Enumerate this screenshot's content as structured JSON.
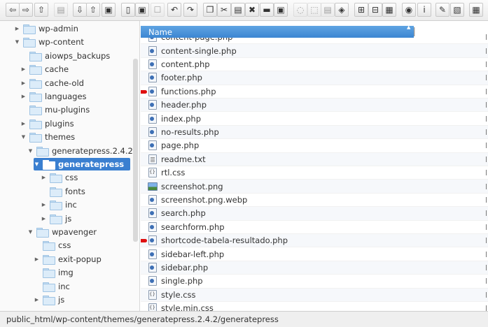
{
  "toolbar": {
    "buttons": [
      {
        "name": "back-icon",
        "glyph": "⇦"
      },
      {
        "name": "forward-icon",
        "glyph": "⇨"
      },
      {
        "name": "up-icon",
        "glyph": "⇧"
      },
      {
        "name": "home-icon",
        "glyph": "▤"
      },
      {
        "name": "download-icon",
        "glyph": "⇩"
      },
      {
        "name": "upload-icon",
        "glyph": "⇧"
      },
      {
        "name": "save-icon",
        "glyph": "▣"
      },
      {
        "name": "open-icon",
        "glyph": "▯"
      },
      {
        "name": "disk-icon",
        "glyph": "▣"
      },
      {
        "name": "checkbox-icon",
        "glyph": "☐"
      },
      {
        "name": "undo-icon",
        "glyph": "↶"
      },
      {
        "name": "redo-icon",
        "glyph": "↷"
      },
      {
        "name": "copy-icon",
        "glyph": "❐"
      },
      {
        "name": "cut-icon",
        "glyph": "✂"
      },
      {
        "name": "paste-icon",
        "glyph": "▤"
      },
      {
        "name": "delete-icon",
        "glyph": "✖"
      },
      {
        "name": "empty-icon",
        "glyph": "▬"
      },
      {
        "name": "rename-icon",
        "glyph": "▣"
      },
      {
        "name": "duplicate-icon",
        "glyph": "◌"
      },
      {
        "name": "select-icon",
        "glyph": "⬚"
      },
      {
        "name": "extract-icon",
        "glyph": "▤"
      },
      {
        "name": "archive-icon",
        "glyph": "◈"
      },
      {
        "name": "icons-view-icon",
        "glyph": "⊞"
      },
      {
        "name": "list-view-icon",
        "glyph": "⊟"
      },
      {
        "name": "grid-view-icon",
        "glyph": "▦"
      },
      {
        "name": "preview-icon",
        "glyph": "◉"
      },
      {
        "name": "info-icon",
        "glyph": "i"
      },
      {
        "name": "edit-icon",
        "glyph": "✎"
      },
      {
        "name": "resize-icon",
        "glyph": "▧"
      },
      {
        "name": "sort-icon",
        "glyph": "▦"
      }
    ]
  },
  "tree": {
    "items": [
      {
        "label": "wp-admin",
        "level": 1,
        "arrow": "▶"
      },
      {
        "label": "wp-content",
        "level": 1,
        "arrow": "▼"
      },
      {
        "label": "aiowps_backups",
        "level": 2,
        "arrow": ""
      },
      {
        "label": "cache",
        "level": 2,
        "arrow": "▶"
      },
      {
        "label": "cache-old",
        "level": 2,
        "arrow": "▶"
      },
      {
        "label": "languages",
        "level": 2,
        "arrow": "▶"
      },
      {
        "label": "mu-plugins",
        "level": 2,
        "arrow": ""
      },
      {
        "label": "plugins",
        "level": 2,
        "arrow": "▶"
      },
      {
        "label": "themes",
        "level": 2,
        "arrow": "▼"
      },
      {
        "label": "generatepress.2.4.2",
        "level": 3,
        "arrow": "▼"
      },
      {
        "label": "generatepress",
        "level": 4,
        "arrow": "▼",
        "selected": true
      },
      {
        "label": "css",
        "level": 5,
        "arrow": "▶"
      },
      {
        "label": "fonts",
        "level": 5,
        "arrow": ""
      },
      {
        "label": "inc",
        "level": 5,
        "arrow": "▶"
      },
      {
        "label": "js",
        "level": 5,
        "arrow": "▶"
      },
      {
        "label": "wpavenger",
        "level": 3,
        "arrow": "▼"
      },
      {
        "label": "css",
        "level": 4,
        "arrow": ""
      },
      {
        "label": "exit-popup",
        "level": 4,
        "arrow": "▶"
      },
      {
        "label": "img",
        "level": 4,
        "arrow": ""
      },
      {
        "label": "inc",
        "level": 4,
        "arrow": ""
      },
      {
        "label": "js",
        "level": 4,
        "arrow": "▶"
      }
    ]
  },
  "list": {
    "column_name": "Name",
    "files": [
      {
        "name": "content-page.php",
        "type": "php"
      },
      {
        "name": "content-single.php",
        "type": "php"
      },
      {
        "name": "content.php",
        "type": "php"
      },
      {
        "name": "footer.php",
        "type": "php"
      },
      {
        "name": "functions.php",
        "type": "php",
        "marked": true
      },
      {
        "name": "header.php",
        "type": "php"
      },
      {
        "name": "index.php",
        "type": "php"
      },
      {
        "name": "no-results.php",
        "type": "php"
      },
      {
        "name": "page.php",
        "type": "php"
      },
      {
        "name": "readme.txt",
        "type": "txt"
      },
      {
        "name": "rtl.css",
        "type": "css"
      },
      {
        "name": "screenshot.png",
        "type": "img"
      },
      {
        "name": "screenshot.png.webp",
        "type": "php"
      },
      {
        "name": "search.php",
        "type": "php"
      },
      {
        "name": "searchform.php",
        "type": "php"
      },
      {
        "name": "shortcode-tabela-resultado.php",
        "type": "php",
        "marked": true
      },
      {
        "name": "sidebar-left.php",
        "type": "php"
      },
      {
        "name": "sidebar.php",
        "type": "php"
      },
      {
        "name": "single.php",
        "type": "php"
      },
      {
        "name": "style.css",
        "type": "css"
      },
      {
        "name": "style.min.css",
        "type": "css"
      }
    ]
  },
  "status": {
    "path": "public_html/wp-content/themes/generatepress.2.4.2/generatepress"
  },
  "colors": {
    "selection": "#3a7fd0",
    "header": "#4a92da",
    "marker": "#e01010"
  }
}
